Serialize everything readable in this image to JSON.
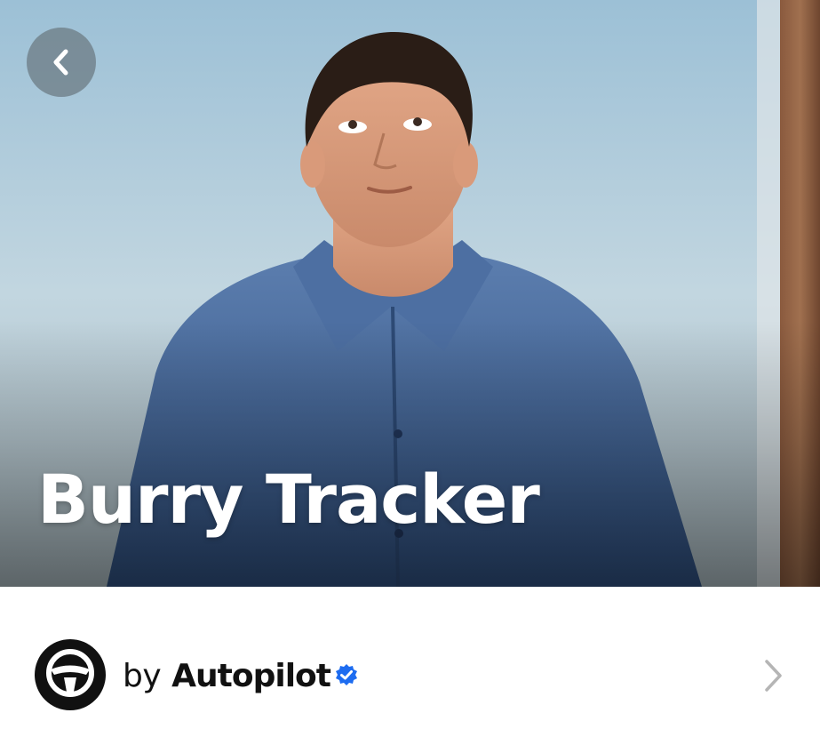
{
  "hero": {
    "title": "Burry Tracker",
    "back_icon": "chevron-left-icon",
    "image_subject": "portrait-photo"
  },
  "author": {
    "prefix": "by",
    "name": "Autopilot",
    "avatar_icon": "steering-wheel-icon",
    "verified_icon": "verified-badge-icon",
    "chevron_icon": "chevron-right-icon"
  },
  "colors": {
    "verified_blue": "#1d6cf0",
    "title_text": "#ffffff",
    "author_text": "#111111",
    "chevron": "#b5b5b5",
    "back_button_bg": "#6e7d87"
  }
}
